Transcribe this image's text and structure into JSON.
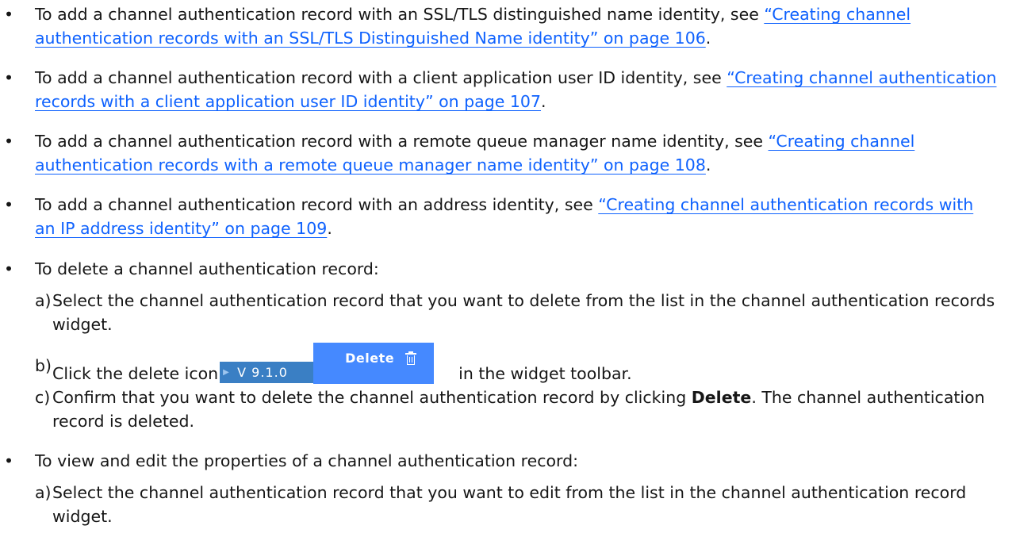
{
  "bullets": [
    {
      "symbol": "•",
      "text_before": "To add a channel authentication record with an SSL/TLS distinguished name identity, see ",
      "link": "“Creating channel authentication records with an SSL/TLS Distinguished Name identity” on page 106",
      "text_after": "."
    },
    {
      "symbol": "•",
      "text_before": "To add a channel authentication record with a client application user ID identity, see ",
      "link": "“Creating channel authentication records with a client application user ID identity” on page 107",
      "text_after": "."
    },
    {
      "symbol": "•",
      "text_before": "To add a channel authentication record with a remote queue manager name identity, see ",
      "link": "“Creating channel authentication records with a remote queue manager name identity” on page 108",
      "text_after": "."
    },
    {
      "symbol": "•",
      "text_before": "To add a channel authentication record with an address identity, see ",
      "link": "“Creating channel authentication records with an IP address identity” on page 109",
      "text_after": "."
    },
    {
      "symbol": "•",
      "text": "To delete a channel authentication record:"
    },
    {
      "symbol": "•",
      "text": "To view and edit the properties of a channel authentication record:"
    }
  ],
  "delete_steps": [
    {
      "letter": "a)",
      "text": "Select the channel authentication record that you want to delete from the list in the channel authentication records widget."
    },
    {
      "letter": "b)",
      "text_before": "Click the delete icon",
      "version_badge": "V 9.1.0",
      "delete_button_label": "Delete",
      "text_after": "in the widget toolbar."
    },
    {
      "letter": "c)",
      "text_before": "Confirm that you want to delete the channel authentication record by clicking ",
      "bold": "Delete",
      "text_after": ". The channel authentication record is deleted."
    }
  ],
  "edit_steps": [
    {
      "letter": "a)",
      "text": "Select the channel authentication record that you want to edit from the list in the channel authentication record widget."
    }
  ],
  "colors": {
    "link": "#0f62fe",
    "badge": "#3a7fc4",
    "button": "#4589ff",
    "text": "#161616"
  },
  "icons": {
    "delete_button": "trash-icon",
    "version_badge": "play-arrow-icon"
  }
}
